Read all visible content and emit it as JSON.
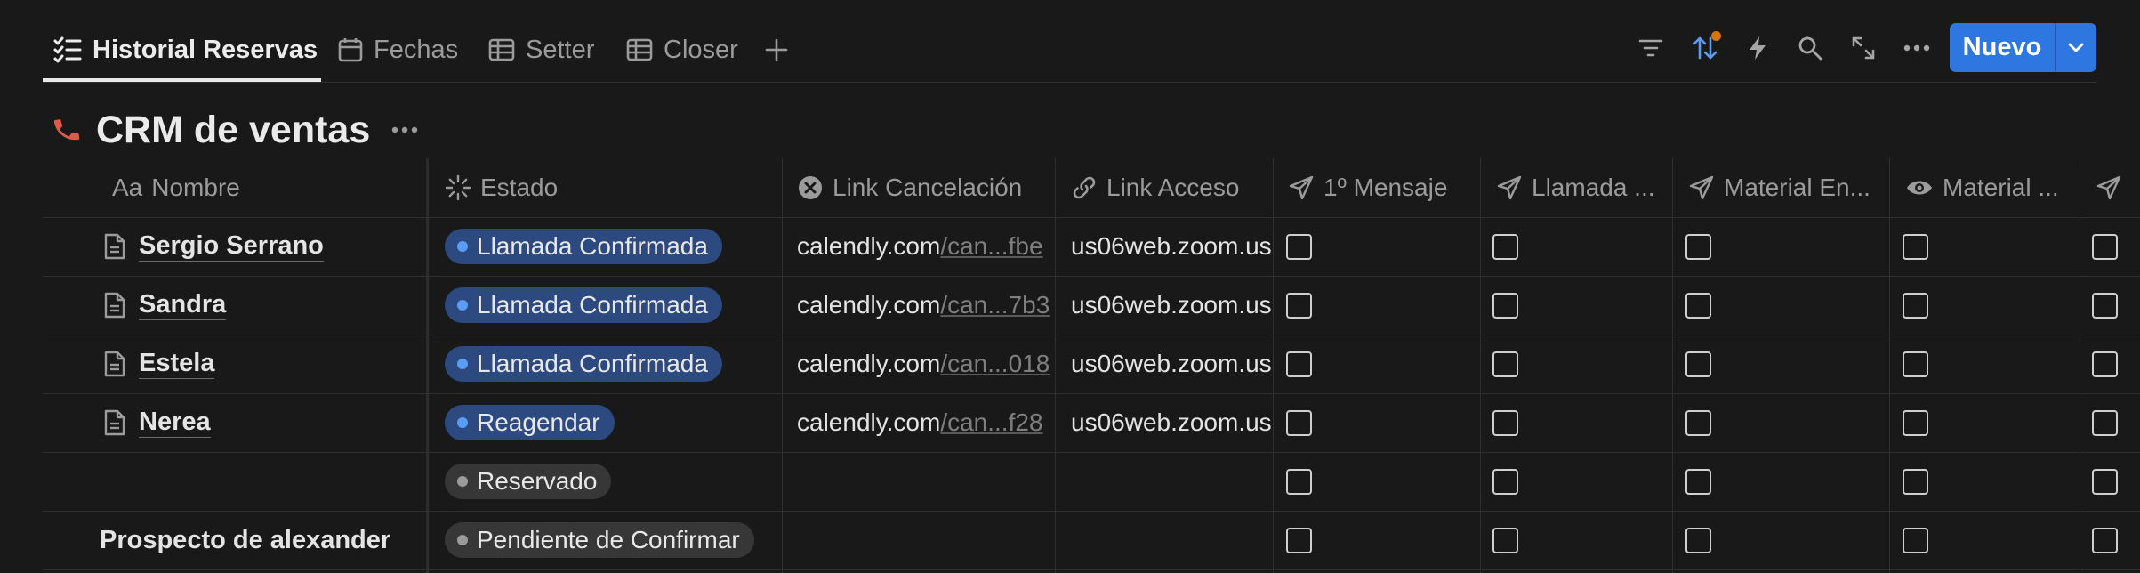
{
  "tabs": [
    {
      "label": "Historial Reservas",
      "icon": "checklist-icon",
      "active": true
    },
    {
      "label": "Fechas",
      "icon": "calendar-icon",
      "active": false
    },
    {
      "label": "Setter",
      "icon": "table-icon",
      "active": false
    },
    {
      "label": "Closer",
      "icon": "table-icon",
      "active": false
    }
  ],
  "toolbar": {
    "new_label": "Nuevo",
    "accent": "#2f77e0",
    "sort_indicator_color": "#d9730d"
  },
  "page": {
    "title": "CRM de ventas",
    "icon": "phone-icon",
    "icon_color": "#e05a47"
  },
  "columns": [
    {
      "label": "Nombre",
      "icon_text": "Aa"
    },
    {
      "label": "Estado",
      "icon": "status-icon"
    },
    {
      "label": "Link Cancelación",
      "icon": "x-circle-icon"
    },
    {
      "label": "Link Acceso",
      "icon": "link-icon"
    },
    {
      "label": "1º Mensaje",
      "icon": "send-icon"
    },
    {
      "label": "Llamada ...",
      "icon": "send-icon"
    },
    {
      "label": "Material En...",
      "icon": "send-icon"
    },
    {
      "label": "Material ...",
      "icon": "eye-icon"
    }
  ],
  "rows": [
    {
      "name": "Sergio Serrano",
      "has_page_icon": true,
      "status": "Llamada Confirmada",
      "status_bg": "#2c4a80",
      "status_dot": "#5b9cf5",
      "cancel_domain": "calendly.com",
      "cancel_path": "/can...fbe",
      "access": "us06web.zoom.us"
    },
    {
      "name": "Sandra",
      "has_page_icon": true,
      "status": "Llamada Confirmada",
      "status_bg": "#2c4a80",
      "status_dot": "#5b9cf5",
      "cancel_domain": "calendly.com",
      "cancel_path": "/can...7b3",
      "access": "us06web.zoom.us"
    },
    {
      "name": "Estela",
      "has_page_icon": true,
      "status": "Llamada Confirmada",
      "status_bg": "#2c4a80",
      "status_dot": "#5b9cf5",
      "cancel_domain": "calendly.com",
      "cancel_path": "/can...018",
      "access": "us06web.zoom.us"
    },
    {
      "name": "Nerea",
      "has_page_icon": true,
      "status": "Reagendar",
      "status_bg": "#2c4a80",
      "status_dot": "#5b9cf5",
      "cancel_domain": "calendly.com",
      "cancel_path": "/can...f28",
      "access": "us06web.zoom.us"
    },
    {
      "name": "",
      "has_page_icon": false,
      "status": "Reservado",
      "status_bg": "#373737",
      "status_dot": "#9b9b9b",
      "cancel_domain": "",
      "cancel_path": "",
      "access": ""
    },
    {
      "name": "Prospecto de alexander",
      "has_page_icon": false,
      "status": "Pendiente de Confirmar",
      "status_bg": "#373737",
      "status_dot": "#9b9b9b",
      "cancel_domain": "",
      "cancel_path": "",
      "access": ""
    }
  ]
}
